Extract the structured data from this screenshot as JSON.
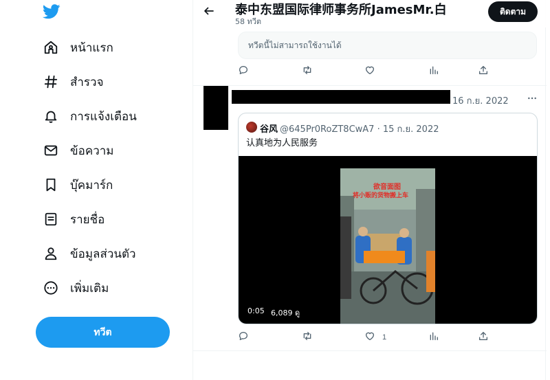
{
  "sidebar": {
    "logo": "twitter-bird-icon",
    "items": [
      {
        "label": "หน้าแรก",
        "icon": "home-icon"
      },
      {
        "label": "สำรวจ",
        "icon": "hashtag-icon"
      },
      {
        "label": "การแจ้งเตือน",
        "icon": "bell-icon"
      },
      {
        "label": "ข้อความ",
        "icon": "mail-icon"
      },
      {
        "label": "บุ๊คมาร์ก",
        "icon": "bookmark-icon"
      },
      {
        "label": "รายชื่อ",
        "icon": "list-icon"
      },
      {
        "label": "ข้อมูลส่วนตัว",
        "icon": "person-icon"
      },
      {
        "label": "เพิ่มเติม",
        "icon": "more-circle-icon"
      }
    ],
    "tweet_button": "ทวีต"
  },
  "header": {
    "title": "泰中东盟国际律师事务所JamesMr.白",
    "subtitle": "58 ทวีต",
    "follow_label": "ติดตาม"
  },
  "unavailable_notice": "ทวีตนี้ไม่สามารถใช้งานได้",
  "tweet": {
    "date": "16 ก.ย. 2022",
    "like_count": "1",
    "quote": {
      "author": "谷风",
      "handle_date": "@645Pr0RoZT8CwA7 · 15 ก.ย. 2022",
      "text": "认真地为人民服务",
      "video_overlay_text": [
        "欲音面图",
        "将小贩的货物搬上车"
      ],
      "video_time": "0:05",
      "video_views": "6,089 ดู"
    }
  },
  "colors": {
    "accent": "#1d9bf0",
    "text": "#0f1419",
    "secondary": "#536471",
    "border": "#cfd9de"
  }
}
